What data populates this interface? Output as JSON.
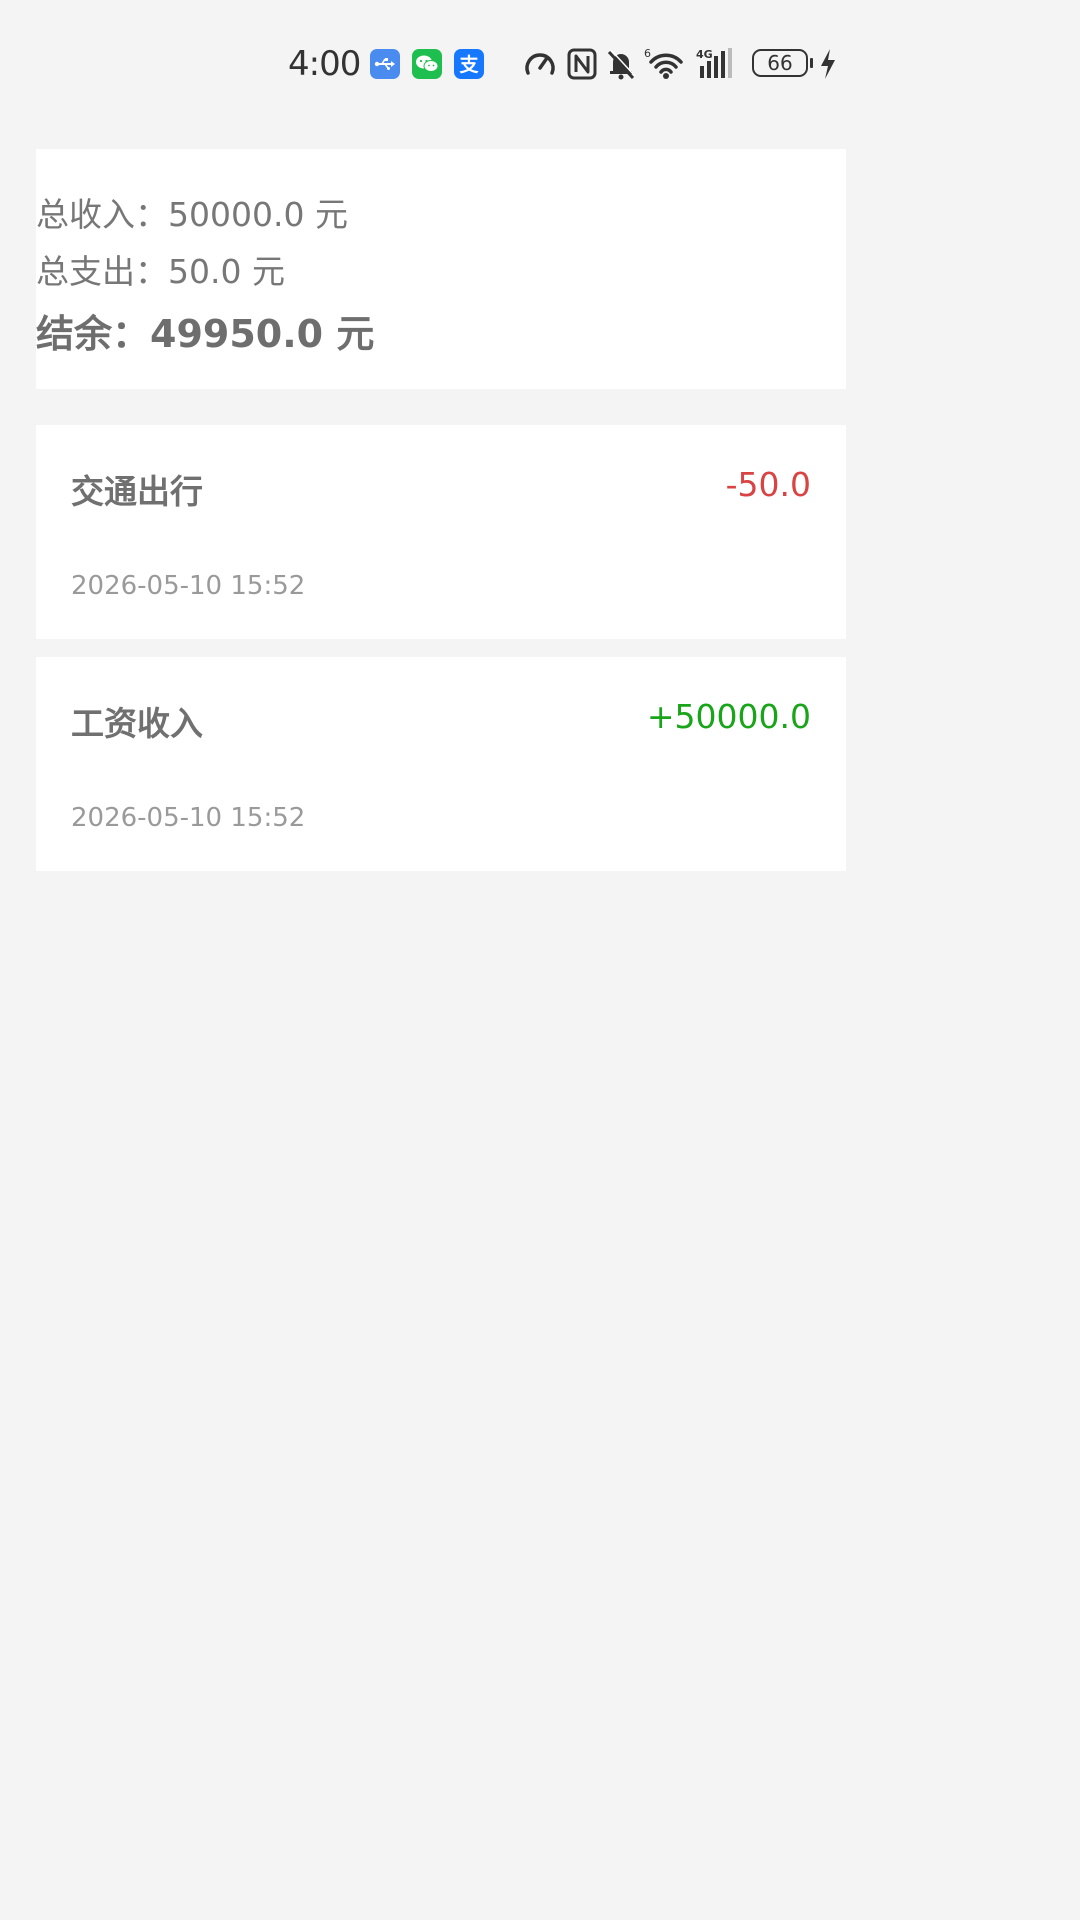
{
  "status_bar": {
    "time": "4:00",
    "battery": "66",
    "signal_label": "4G",
    "wifi_label": "6"
  },
  "summary": {
    "income_label": "总收入：",
    "income_value": "50000.0 元",
    "expense_label": "总支出：",
    "expense_value": "50.0 元",
    "balance_label": "结余：",
    "balance_value": "49950.0 元"
  },
  "transactions": [
    {
      "category": "交通出行",
      "amount": "-50.0",
      "time": "2026-05-10 15:52",
      "color": "#d94343"
    },
    {
      "category": "工资收入",
      "amount": "+50000.0",
      "time": "2026-05-10 15:52",
      "color": "#19a519"
    }
  ],
  "colors": {
    "background": "#f4f4f4",
    "card": "#ffffff",
    "expense": "#d94343",
    "income": "#19a519"
  }
}
